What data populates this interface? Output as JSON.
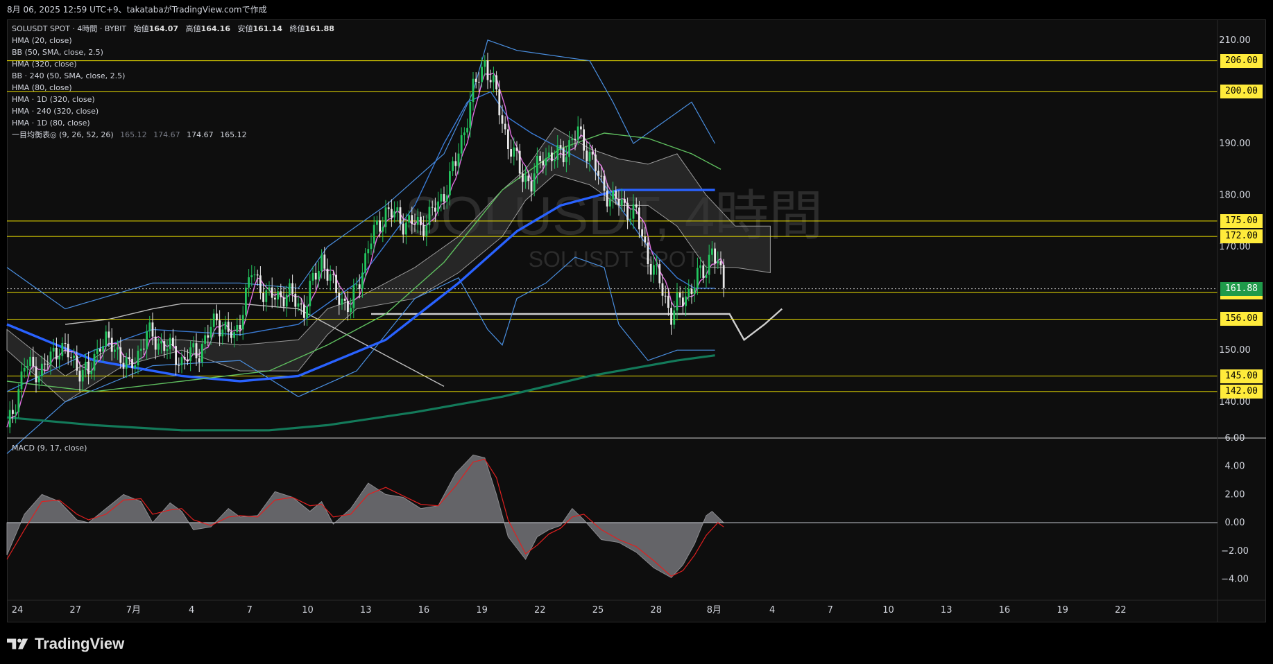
{
  "header": {
    "text": "8月 06, 2025 12:59 UTC+9、takatabaがTradingView.comで作成"
  },
  "legend": {
    "symbol": "SOLUSDT SPOT · 4時間 · BYBIT",
    "ohlc": [
      {
        "label": "始値",
        "value": "164.07"
      },
      {
        "label": "高値",
        "value": "164.16"
      },
      {
        "label": "安値",
        "value": "161.14"
      },
      {
        "label": "終値",
        "value": "161.88"
      }
    ],
    "indicators": [
      "HMA (20, close)",
      "BB (50, SMA, close, 2.5)",
      "HMA (320, close)",
      "BB · 240 (50, SMA, close, 2.5)",
      "HMA (80, close)",
      "HMA · 1D (320, close)",
      "HMA · 240 (320, close)",
      "HMA · 1D (80, close)"
    ],
    "ichimoku": {
      "label": "一目均衡表◎ (9, 26, 52, 26)",
      "values": [
        "165.12",
        "174.67",
        "174.67",
        "165.12"
      ]
    }
  },
  "watermark": {
    "big": "SOLUSDT, 4時間",
    "small": "SOLUSDT SPOT"
  },
  "macd_legend": "MACD (9, 17, close)",
  "footer": {
    "brand": "TradingView"
  },
  "colors": {
    "background": "#0e0e0e",
    "up": "#22c55e",
    "down": "#e8e8e8",
    "hma20": "#e070e0",
    "bb": "#4a8fe0",
    "hma320": "#2962ff",
    "hma80_1d": "#137a5a",
    "hma240": "#5fbf5f",
    "horizontal": "#f2e600",
    "macd_hist": "#6e6e72",
    "signal": "#e02020",
    "last_price_tag": "#1f9a4a",
    "level_tag": "#ffeb3b"
  },
  "chart_data": [
    {
      "type": "candlestick",
      "title": "SOLUSDT SPOT · 4時間 · BYBIT",
      "price_axis": {
        "ticks": [
          "210.00",
          "190.00",
          "180.00",
          "170.00",
          "150.00",
          "140.00"
        ],
        "range": [
          133,
          214
        ]
      },
      "time_axis": {
        "ticks": [
          "24",
          "27",
          "7月",
          "4",
          "7",
          "10",
          "13",
          "16",
          "19",
          "22",
          "25",
          "28",
          "8月",
          "4",
          "7",
          "10",
          "13",
          "16",
          "19",
          "22"
        ]
      },
      "horizontal_levels": [
        {
          "value": 206.0,
          "label": "206.00"
        },
        {
          "value": 200.0,
          "label": "200.00"
        },
        {
          "value": 175.0,
          "label": "175.00"
        },
        {
          "value": 172.0,
          "label": "172.00"
        },
        {
          "value": 161.2,
          "label": "161.20"
        },
        {
          "value": 156.0,
          "label": "156.00"
        },
        {
          "value": 145.0,
          "label": "145.00"
        },
        {
          "value": 142.0,
          "label": "142.00"
        }
      ],
      "last_price": {
        "value": 161.88,
        "label": "161.88"
      },
      "price_path": [
        [
          0,
          134
        ],
        [
          6,
          147
        ],
        [
          12,
          146
        ],
        [
          18,
          151
        ],
        [
          24,
          147
        ],
        [
          28,
          145
        ],
        [
          32,
          152
        ],
        [
          38,
          150
        ],
        [
          42,
          146
        ],
        [
          48,
          153
        ],
        [
          54,
          151
        ],
        [
          60,
          148
        ],
        [
          66,
          150
        ],
        [
          72,
          156
        ],
        [
          78,
          152
        ],
        [
          84,
          165
        ],
        [
          90,
          160
        ],
        [
          96,
          161
        ],
        [
          102,
          158
        ],
        [
          108,
          168
        ],
        [
          112,
          162
        ],
        [
          118,
          158
        ],
        [
          124,
          170
        ],
        [
          130,
          177
        ],
        [
          136,
          175
        ],
        [
          142,
          174
        ],
        [
          148,
          178
        ],
        [
          154,
          186
        ],
        [
          160,
          200
        ],
        [
          164,
          206
        ],
        [
          168,
          199
        ],
        [
          172,
          190
        ],
        [
          176,
          185
        ],
        [
          180,
          182
        ],
        [
          184,
          188
        ],
        [
          188,
          187
        ],
        [
          192,
          189
        ],
        [
          196,
          192
        ],
        [
          200,
          188
        ],
        [
          204,
          182
        ],
        [
          208,
          179
        ],
        [
          212,
          178
        ],
        [
          216,
          176
        ],
        [
          220,
          168
        ],
        [
          224,
          163
        ],
        [
          228,
          157
        ],
        [
          232,
          160
        ],
        [
          236,
          163
        ],
        [
          240,
          166
        ],
        [
          242,
          170
        ],
        [
          244,
          166
        ],
        [
          246,
          162
        ]
      ],
      "ichimoku": {
        "kumo": [
          [
            0,
            154,
            150
          ],
          [
            20,
            145,
            140
          ],
          [
            40,
            152,
            147
          ],
          [
            60,
            152,
            150
          ],
          [
            80,
            151,
            146
          ],
          [
            100,
            152,
            146
          ],
          [
            110,
            158,
            153
          ],
          [
            120,
            160,
            158
          ],
          [
            140,
            166,
            160
          ],
          [
            155,
            172,
            165
          ],
          [
            170,
            181,
            172
          ],
          [
            178,
            185,
            179
          ],
          [
            188,
            193,
            184
          ],
          [
            200,
            189,
            182
          ],
          [
            210,
            187,
            178
          ],
          [
            220,
            186,
            178
          ],
          [
            230,
            188,
            174
          ],
          [
            240,
            180,
            166
          ],
          [
            250,
            174,
            166
          ],
          [
            262,
            174,
            165
          ]
        ],
        "chikou": [
          [
            20,
            155
          ],
          [
            35,
            156
          ],
          [
            50,
            158
          ],
          [
            60,
            159
          ],
          [
            80,
            159
          ],
          [
            100,
            158
          ],
          [
            110,
            155
          ],
          [
            130,
            149
          ],
          [
            150,
            143
          ]
        ],
        "future_line": [
          [
            125,
            157
          ],
          [
            180,
            157
          ],
          [
            235,
            157
          ],
          [
            248,
            157
          ],
          [
            253,
            152
          ],
          [
            260,
            155
          ],
          [
            266,
            158
          ]
        ]
      },
      "hma_lines": [
        {
          "name": "HMA (320, close)",
          "points": [
            [
              0,
              155
            ],
            [
              30,
              148
            ],
            [
              60,
              145
            ],
            [
              80,
              144
            ],
            [
              100,
              145
            ],
            [
              130,
              152
            ],
            [
              155,
              163
            ],
            [
              175,
              173
            ],
            [
              190,
              178
            ],
            [
              210,
              181
            ],
            [
              230,
              181
            ],
            [
              243,
              181
            ]
          ]
        },
        {
          "name": "HMA · 1D (80, close)",
          "points": [
            [
              0,
              137
            ],
            [
              30,
              135.5
            ],
            [
              60,
              134.5
            ],
            [
              90,
              134.5
            ],
            [
              110,
              135.5
            ],
            [
              140,
              138
            ],
            [
              170,
              141
            ],
            [
              200,
              145
            ],
            [
              230,
              148
            ],
            [
              243,
              149
            ]
          ]
        },
        {
          "name": "HMA · 240 (320, close)",
          "points": [
            [
              0,
              144
            ],
            [
              30,
              142
            ],
            [
              60,
              144
            ],
            [
              90,
              146
            ],
            [
              110,
              151
            ],
            [
              130,
              157
            ],
            [
              150,
              167
            ],
            [
              170,
              181
            ],
            [
              190,
              189
            ],
            [
              205,
              192
            ],
            [
              220,
              191
            ],
            [
              235,
              188
            ],
            [
              245,
              185
            ]
          ]
        }
      ],
      "bollinger": {
        "upper": [
          [
            0,
            166
          ],
          [
            20,
            158
          ],
          [
            50,
            163
          ],
          [
            80,
            163
          ],
          [
            100,
            162
          ],
          [
            110,
            170
          ],
          [
            130,
            178
          ],
          [
            150,
            188
          ],
          [
            160,
            200
          ],
          [
            165,
            210
          ],
          [
            175,
            208
          ],
          [
            200,
            206
          ],
          [
            208,
            198
          ],
          [
            215,
            190
          ],
          [
            225,
            194
          ],
          [
            235,
            198
          ],
          [
            243,
            190
          ]
        ],
        "lower": [
          [
            0,
            130
          ],
          [
            20,
            140
          ],
          [
            50,
            147
          ],
          [
            80,
            148
          ],
          [
            100,
            141
          ],
          [
            120,
            146
          ],
          [
            140,
            160
          ],
          [
            155,
            164
          ],
          [
            165,
            154
          ],
          [
            170,
            151
          ],
          [
            175,
            160
          ],
          [
            185,
            163
          ],
          [
            195,
            168
          ],
          [
            205,
            166
          ],
          [
            210,
            155
          ],
          [
            220,
            148
          ],
          [
            230,
            150
          ],
          [
            236,
            150
          ],
          [
            243,
            150
          ]
        ],
        "basis": [
          [
            0,
            142
          ],
          [
            30,
            150
          ],
          [
            50,
            154
          ],
          [
            80,
            153
          ],
          [
            100,
            155
          ],
          [
            120,
            163
          ],
          [
            140,
            178
          ],
          [
            150,
            190
          ],
          [
            158,
            198
          ],
          [
            166,
            200
          ],
          [
            172,
            195
          ],
          [
            180,
            192
          ],
          [
            200,
            186
          ],
          [
            210,
            178
          ],
          [
            220,
            170
          ],
          [
            230,
            164
          ],
          [
            236,
            162
          ],
          [
            243,
            162
          ]
        ]
      }
    },
    {
      "type": "area",
      "title": "MACD (9, 17, close)",
      "ylim": [
        -5.5,
        6.0
      ],
      "y_ticks": [
        "6.00",
        "4.00",
        "2.00",
        "0.00",
        "−2.00",
        "−4.00"
      ],
      "histogram": [
        [
          0,
          -2.3
        ],
        [
          6,
          0.6
        ],
        [
          12,
          2.0
        ],
        [
          18,
          1.5
        ],
        [
          24,
          0.2
        ],
        [
          28,
          0.0
        ],
        [
          34,
          1.0
        ],
        [
          40,
          2.0
        ],
        [
          46,
          1.5
        ],
        [
          50,
          0.0
        ],
        [
          56,
          1.4
        ],
        [
          60,
          0.8
        ],
        [
          64,
          -0.5
        ],
        [
          70,
          -0.3
        ],
        [
          76,
          1.0
        ],
        [
          80,
          0.4
        ],
        [
          86,
          0.5
        ],
        [
          92,
          2.2
        ],
        [
          98,
          1.8
        ],
        [
          104,
          0.8
        ],
        [
          108,
          1.5
        ],
        [
          112,
          -0.1
        ],
        [
          118,
          1.0
        ],
        [
          124,
          2.8
        ],
        [
          130,
          2.0
        ],
        [
          136,
          1.8
        ],
        [
          142,
          1.0
        ],
        [
          148,
          1.2
        ],
        [
          154,
          3.5
        ],
        [
          160,
          4.8
        ],
        [
          164,
          4.6
        ],
        [
          168,
          2.0
        ],
        [
          172,
          -1.0
        ],
        [
          178,
          -2.6
        ],
        [
          182,
          -1.0
        ],
        [
          186,
          -0.5
        ],
        [
          190,
          -0.2
        ],
        [
          194,
          1.0
        ],
        [
          198,
          0.2
        ],
        [
          204,
          -1.2
        ],
        [
          210,
          -1.4
        ],
        [
          216,
          -2.1
        ],
        [
          222,
          -3.2
        ],
        [
          228,
          -3.9
        ],
        [
          232,
          -3.0
        ],
        [
          236,
          -1.5
        ],
        [
          240,
          0.5
        ],
        [
          242,
          0.8
        ],
        [
          246,
          0.0
        ]
      ],
      "signal": [
        [
          0,
          -2.6
        ],
        [
          6,
          -0.5
        ],
        [
          12,
          1.5
        ],
        [
          18,
          1.6
        ],
        [
          24,
          0.6
        ],
        [
          28,
          0.2
        ],
        [
          34,
          0.6
        ],
        [
          40,
          1.6
        ],
        [
          46,
          1.7
        ],
        [
          50,
          0.6
        ],
        [
          56,
          0.9
        ],
        [
          60,
          1.0
        ],
        [
          64,
          0.2
        ],
        [
          70,
          -0.2
        ],
        [
          76,
          0.4
        ],
        [
          80,
          0.5
        ],
        [
          86,
          0.4
        ],
        [
          92,
          1.6
        ],
        [
          98,
          1.8
        ],
        [
          104,
          1.2
        ],
        [
          108,
          1.3
        ],
        [
          112,
          0.4
        ],
        [
          118,
          0.6
        ],
        [
          124,
          2.0
        ],
        [
          130,
          2.5
        ],
        [
          136,
          1.9
        ],
        [
          142,
          1.3
        ],
        [
          148,
          1.2
        ],
        [
          154,
          2.6
        ],
        [
          160,
          4.3
        ],
        [
          164,
          4.5
        ],
        [
          168,
          3.2
        ],
        [
          172,
          0.2
        ],
        [
          178,
          -2.2
        ],
        [
          182,
          -1.6
        ],
        [
          186,
          -0.8
        ],
        [
          190,
          -0.4
        ],
        [
          194,
          0.4
        ],
        [
          198,
          0.6
        ],
        [
          204,
          -0.5
        ],
        [
          210,
          -1.2
        ],
        [
          216,
          -1.7
        ],
        [
          222,
          -2.7
        ],
        [
          228,
          -3.8
        ],
        [
          232,
          -3.4
        ],
        [
          236,
          -2.3
        ],
        [
          240,
          -0.9
        ],
        [
          244,
          0.0
        ],
        [
          246,
          -0.3
        ]
      ]
    }
  ]
}
